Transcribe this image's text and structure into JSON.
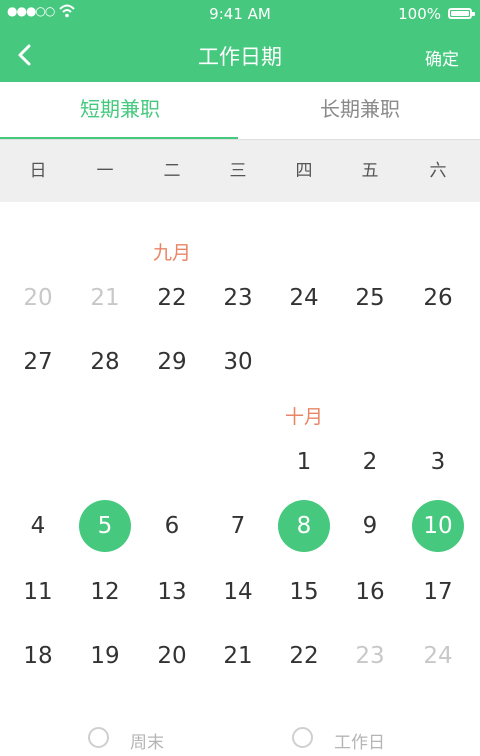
{
  "status_bar": {
    "time": "9:41 AM",
    "battery": "100%",
    "signal": "●●●○○"
  },
  "nav": {
    "title": "工作日期",
    "confirm_label": "确定"
  },
  "tabs": [
    {
      "label": "短期兼职",
      "active": true
    },
    {
      "label": "长期兼职",
      "active": false
    }
  ],
  "weekdays": [
    "日",
    "一",
    "二",
    "三",
    "四",
    "五",
    "六"
  ],
  "months": [
    {
      "label": "九月",
      "weeks": [
        [
          {
            "d": "20",
            "muted": true
          },
          {
            "d": "21",
            "muted": true
          },
          {
            "d": "22"
          },
          {
            "d": "23"
          },
          {
            "d": "24"
          },
          {
            "d": "25"
          },
          {
            "d": "26"
          }
        ],
        [
          {
            "d": "27"
          },
          {
            "d": "28"
          },
          {
            "d": "29"
          },
          {
            "d": "30"
          },
          null,
          null,
          null
        ]
      ]
    },
    {
      "label": "十月",
      "weeks": [
        [
          null,
          null,
          null,
          null,
          {
            "d": "1"
          },
          {
            "d": "2"
          },
          {
            "d": "3"
          }
        ],
        [
          {
            "d": "4"
          },
          {
            "d": "5",
            "selected": true
          },
          {
            "d": "6"
          },
          {
            "d": "7"
          },
          {
            "d": "8",
            "selected": true
          },
          {
            "d": "9"
          },
          {
            "d": "10",
            "selected": true
          }
        ],
        [
          {
            "d": "11"
          },
          {
            "d": "12"
          },
          {
            "d": "13"
          },
          {
            "d": "14"
          },
          {
            "d": "15"
          },
          {
            "d": "16"
          },
          {
            "d": "17"
          }
        ],
        [
          {
            "d": "18"
          },
          {
            "d": "19"
          },
          {
            "d": "20"
          },
          {
            "d": "21"
          },
          {
            "d": "22"
          },
          {
            "d": "23",
            "muted": true
          },
          {
            "d": "24",
            "muted": true
          }
        ]
      ]
    }
  ],
  "options": [
    {
      "label": "周末"
    },
    {
      "label": "工作日"
    }
  ],
  "colors": {
    "accent": "#46c97e",
    "month_label": "#e98565",
    "muted_day": "#c8c8c8"
  }
}
